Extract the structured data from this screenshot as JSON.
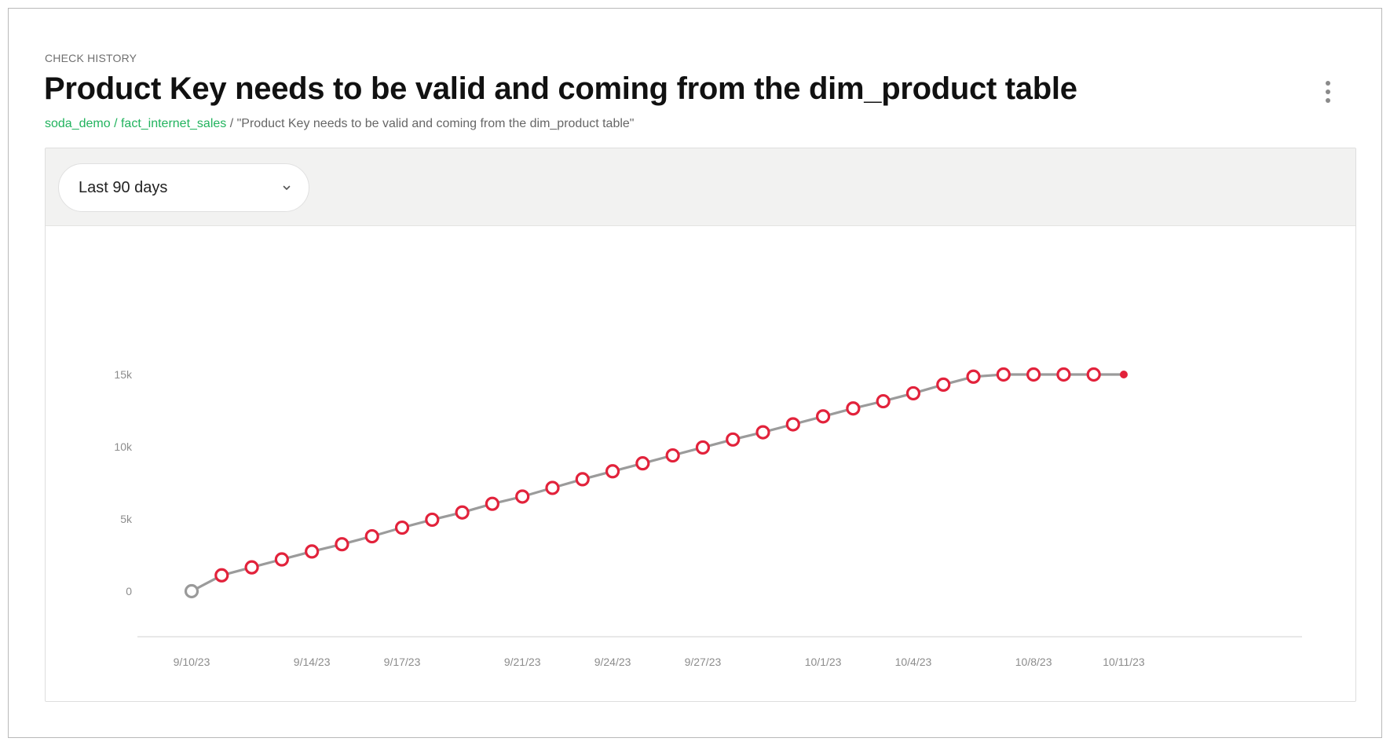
{
  "header": {
    "eyebrow": "CHECK HISTORY",
    "title": "Product Key needs to be valid and coming from the dim_product table",
    "menu_icon": "more-vertical-icon"
  },
  "breadcrumb": {
    "datasource": "soda_demo",
    "separator": " / ",
    "dataset": "fact_internet_sales",
    "check": " / \"Product Key needs to be valid and coming from the dim_product table\""
  },
  "filter": {
    "selected": "Last 90 days",
    "icon": "chevron-down-icon"
  },
  "colors": {
    "accent_green": "#22b35e",
    "point_fail": "#e2223b",
    "point_first": "#9a9a9a",
    "line": "#9b9b9b"
  },
  "chart_data": {
    "type": "line",
    "y_ticks": [
      "0",
      "5k",
      "10k",
      "15k"
    ],
    "y_tick_values": [
      0,
      5000,
      10000,
      15000
    ],
    "x_ticks": [
      "9/10/23",
      "9/14/23",
      "9/17/23",
      "9/21/23",
      "9/24/23",
      "9/27/23",
      "10/1/23",
      "10/4/23",
      "10/8/23",
      "10/11/23"
    ],
    "x_start": "2023-09-10",
    "x_end": "2023-10-11",
    "series": [
      {
        "values": [
          0,
          1100,
          1650,
          2200,
          2750,
          3250,
          3800,
          4400,
          4950,
          5450,
          6050,
          6550,
          7150,
          7750,
          8300,
          8850,
          9400,
          9950,
          10500,
          11000,
          11550,
          12100,
          12650,
          13150,
          13700,
          14300,
          14850,
          15000,
          15000,
          15000,
          15000,
          15000
        ],
        "point_status": [
          "neutral",
          "fail",
          "fail",
          "fail",
          "fail",
          "fail",
          "fail",
          "fail",
          "fail",
          "fail",
          "fail",
          "fail",
          "fail",
          "fail",
          "fail",
          "fail",
          "fail",
          "fail",
          "fail",
          "fail",
          "fail",
          "fail",
          "fail",
          "fail",
          "fail",
          "fail",
          "fail",
          "fail",
          "fail",
          "fail",
          "fail",
          "current"
        ]
      }
    ],
    "ylim": [
      -3000,
      15000
    ],
    "grid": false,
    "legend": "none"
  }
}
